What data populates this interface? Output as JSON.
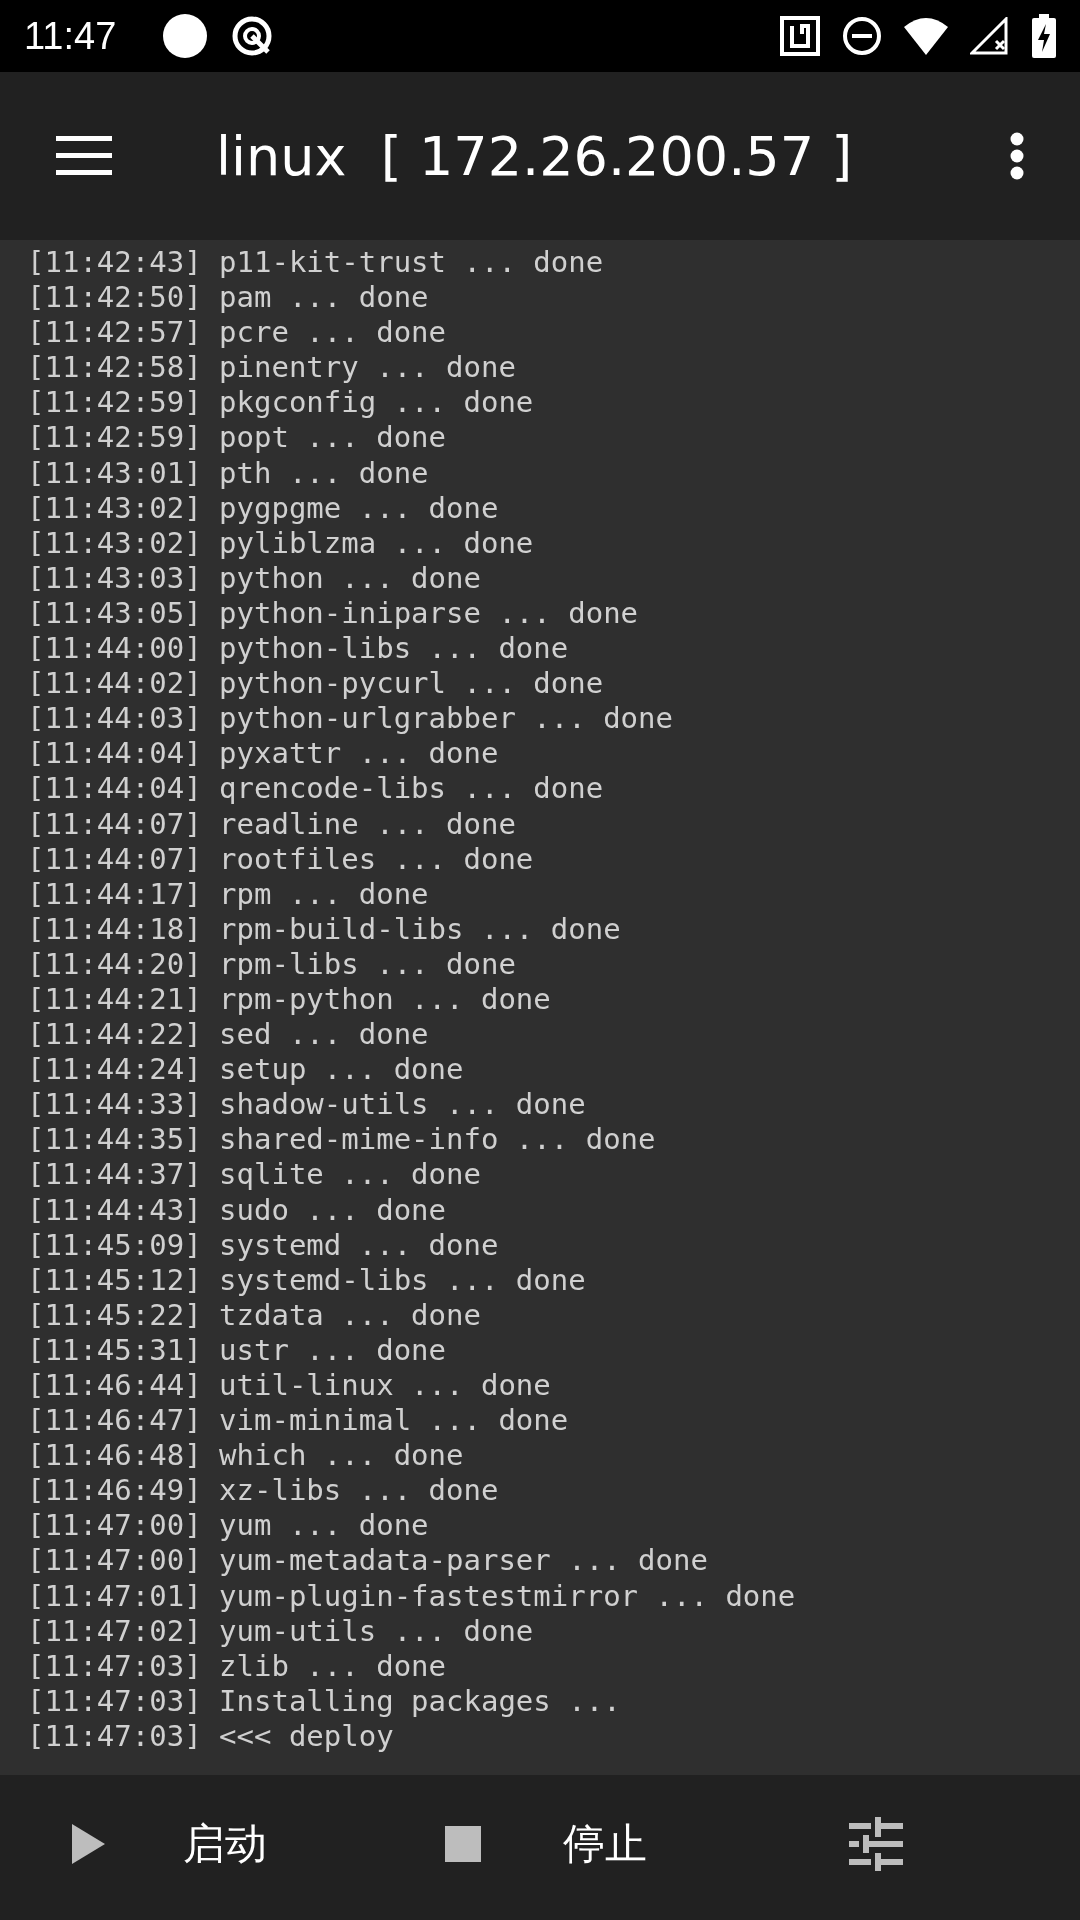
{
  "status_bar": {
    "time": "11:47"
  },
  "app_bar": {
    "title": "linux  [ 172.26.200.57 ]"
  },
  "log": [
    "[11:42:43] p11-kit-trust ... done",
    "[11:42:50] pam ... done",
    "[11:42:57] pcre ... done",
    "[11:42:58] pinentry ... done",
    "[11:42:59] pkgconfig ... done",
    "[11:42:59] popt ... done",
    "[11:43:01] pth ... done",
    "[11:43:02] pygpgme ... done",
    "[11:43:02] pyliblzma ... done",
    "[11:43:03] python ... done",
    "[11:43:05] python-iniparse ... done",
    "[11:44:00] python-libs ... done",
    "[11:44:02] python-pycurl ... done",
    "[11:44:03] python-urlgrabber ... done",
    "[11:44:04] pyxattr ... done",
    "[11:44:04] qrencode-libs ... done",
    "[11:44:07] readline ... done",
    "[11:44:07] rootfiles ... done",
    "[11:44:17] rpm ... done",
    "[11:44:18] rpm-build-libs ... done",
    "[11:44:20] rpm-libs ... done",
    "[11:44:21] rpm-python ... done",
    "[11:44:22] sed ... done",
    "[11:44:24] setup ... done",
    "[11:44:33] shadow-utils ... done",
    "[11:44:35] shared-mime-info ... done",
    "[11:44:37] sqlite ... done",
    "[11:44:43] sudo ... done",
    "[11:45:09] systemd ... done",
    "[11:45:12] systemd-libs ... done",
    "[11:45:22] tzdata ... done",
    "[11:45:31] ustr ... done",
    "[11:46:44] util-linux ... done",
    "[11:46:47] vim-minimal ... done",
    "[11:46:48] which ... done",
    "[11:46:49] xz-libs ... done",
    "[11:47:00] yum ... done",
    "[11:47:00] yum-metadata-parser ... done",
    "[11:47:01] yum-plugin-fastestmirror ... done",
    "[11:47:02] yum-utils ... done",
    "[11:47:03] zlib ... done",
    "[11:47:03] Installing packages ...",
    "[11:47:03] <<< deploy"
  ],
  "bottom_bar": {
    "start_label": "启动",
    "stop_label": "停止"
  }
}
